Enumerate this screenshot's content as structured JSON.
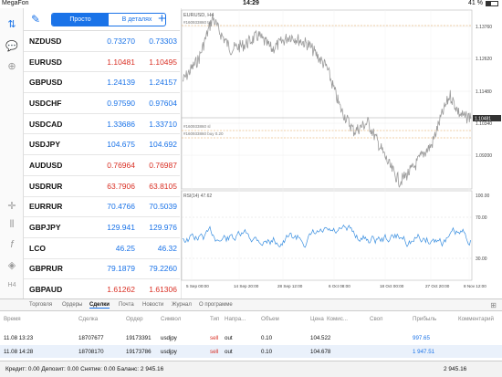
{
  "status": {
    "carrier": "MegaFon",
    "time": "14:29",
    "battery": "41 %",
    "battery_level": 0.41
  },
  "quotes": {
    "mode_simple": "Просто",
    "mode_detailed": "В деталях",
    "rows": [
      {
        "symbol": "NZDUSD",
        "bid": "0.73270",
        "ask": "0.73303",
        "dir": "up"
      },
      {
        "symbol": "EURUSD",
        "bid": "1.10481",
        "ask": "1.10495",
        "dir": "down"
      },
      {
        "symbol": "GBPUSD",
        "bid": "1.24139",
        "ask": "1.24157",
        "dir": "up"
      },
      {
        "symbol": "USDCHF",
        "bid": "0.97590",
        "ask": "0.97604",
        "dir": "up"
      },
      {
        "symbol": "USDCAD",
        "bid": "1.33686",
        "ask": "1.33710",
        "dir": "up"
      },
      {
        "symbol": "USDJPY",
        "bid": "104.675",
        "ask": "104.692",
        "dir": "up"
      },
      {
        "symbol": "AUDUSD",
        "bid": "0.76964",
        "ask": "0.76987",
        "dir": "down"
      },
      {
        "symbol": "USDRUR",
        "bid": "63.7906",
        "ask": "63.8105",
        "dir": "down"
      },
      {
        "symbol": "EURRUR",
        "bid": "70.4766",
        "ask": "70.5039",
        "dir": "up"
      },
      {
        "symbol": "GBPJPY",
        "bid": "129.941",
        "ask": "129.976",
        "dir": "up"
      },
      {
        "symbol": "LCO",
        "bid": "46.25",
        "ask": "46.32",
        "dir": "up"
      },
      {
        "symbol": "GBPRUR",
        "bid": "79.1879",
        "ask": "79.2260",
        "dir": "up"
      },
      {
        "symbol": "GBPAUD",
        "bid": "1.61262",
        "ask": "1.61306",
        "dir": "down"
      }
    ]
  },
  "chart": {
    "symbol_label": "EURUSD, H4",
    "order_label_top": "#160933860 tp",
    "order_label_mid": "#160933860 sl",
    "order_label_buy": "#160933860 buy 0.20",
    "price_ticks": [
      "1.13760",
      "1.12620",
      "1.11480",
      "1.10340",
      "1.09200"
    ],
    "current_price": "1.10481",
    "date_ticks": [
      "5 Sep 00:00",
      "14 Sep 20:00",
      "28 Sep 12:00",
      "6 Oct 08:00",
      "18 Oct 00:00",
      "27 Oct 20:00",
      "8 Nov 12:00"
    ],
    "rsi_label": "RSI(14) 47.62",
    "rsi_ticks": [
      "100.00",
      "70.00",
      "30.00"
    ],
    "colors": {
      "price": "#9a9a9a",
      "rsi": "#3a8fe0",
      "level": "#e0a050"
    }
  },
  "tabs": [
    "Торговля",
    "Ордеры",
    "Сделки",
    "Почта",
    "Новости",
    "Журнал",
    "О программе"
  ],
  "active_tab": "Сделки",
  "trades": {
    "headers": [
      "Время",
      "Сделка",
      "Ордер",
      "Символ",
      "Тип",
      "Напра...",
      "Объем",
      "Цена",
      "Комис...",
      "Своп",
      "Прибыль",
      "Комментарий"
    ],
    "rows": [
      {
        "time": "11.08 13:23",
        "deal": "18707677",
        "order": "19173391",
        "symbol": "usdjpy",
        "type": "sell",
        "dir": "out",
        "volume": "0.10",
        "price": "104.522",
        "commission": "",
        "swap": "",
        "profit": "997.65",
        "comment": ""
      },
      {
        "time": "11.08 14:28",
        "deal": "18708170",
        "order": "19173786",
        "symbol": "usdjpy",
        "type": "sell",
        "dir": "out",
        "volume": "0.10",
        "price": "104.678",
        "commission": "",
        "swap": "",
        "profit": "1 947.51",
        "comment": ""
      }
    ]
  },
  "footer": {
    "summary": "Кредит: 0.00 Депозит: 0.00 Снятие: 0.00 Баланс: 2 945.16",
    "total": "2 945.16"
  }
}
